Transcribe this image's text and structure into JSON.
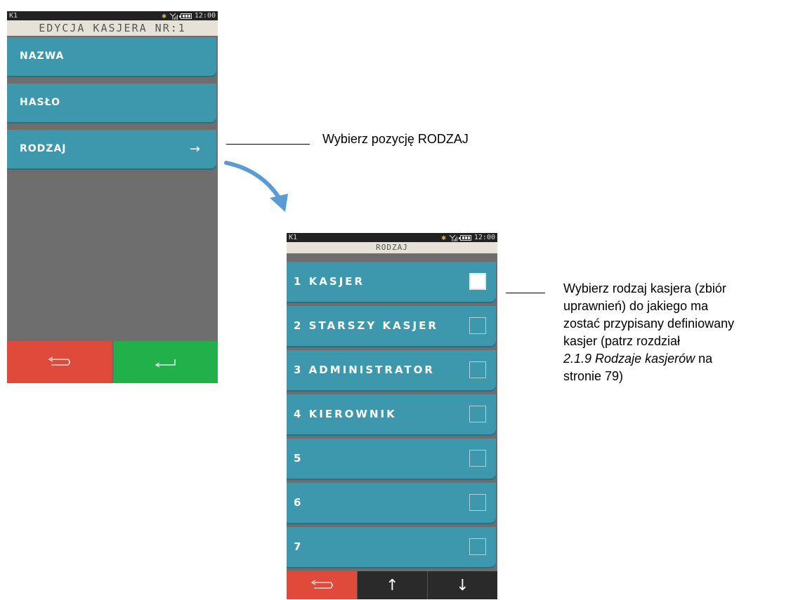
{
  "screen1": {
    "status": {
      "terminal_id": "K1",
      "time": "12:00"
    },
    "title": "EDYCJA KASJERA NR:1",
    "menu": [
      {
        "label": "NAZWA"
      },
      {
        "label": "HASŁO"
      },
      {
        "label": "RODZAJ",
        "arrow": "→"
      }
    ],
    "buttons": {
      "back_icon": "back-arrow-icon",
      "enter_icon": "enter-arrow-icon"
    }
  },
  "screen2": {
    "status": {
      "terminal_id": "K1",
      "time": "12:00"
    },
    "title": "RODZAJ",
    "items": [
      {
        "label": "1 KASJER",
        "checked": true
      },
      {
        "label": "2 STARSZY KASJER",
        "checked": false
      },
      {
        "label": "3 ADMINISTRATOR",
        "checked": false
      },
      {
        "label": "4 KIEROWNIK",
        "checked": false
      },
      {
        "label": "5",
        "checked": false
      },
      {
        "label": "6",
        "checked": false
      },
      {
        "label": "7",
        "checked": false
      }
    ],
    "buttons": {
      "up": "↑",
      "down": "↓"
    }
  },
  "annotations": {
    "select_position": "Wybierz pozycję RODZAJ",
    "select_type_lines": [
      "Wybierz rodzaj kasjera (zbiór",
      "uprawnień) do jakiego ma",
      "zostać przypisany definiowany",
      "kasjer (patrz rozdział"
    ],
    "select_type_italic": "2.1.9 Rodzaje kasjerów",
    "select_type_tail": " na",
    "select_type_last": "stronie 79)"
  },
  "colors": {
    "menu": "#3e98ad",
    "back_button": "#e04a3a",
    "enter_button": "#22b04b",
    "arrow": "#5b9bd5",
    "bluetooth": "#e3b52b"
  }
}
